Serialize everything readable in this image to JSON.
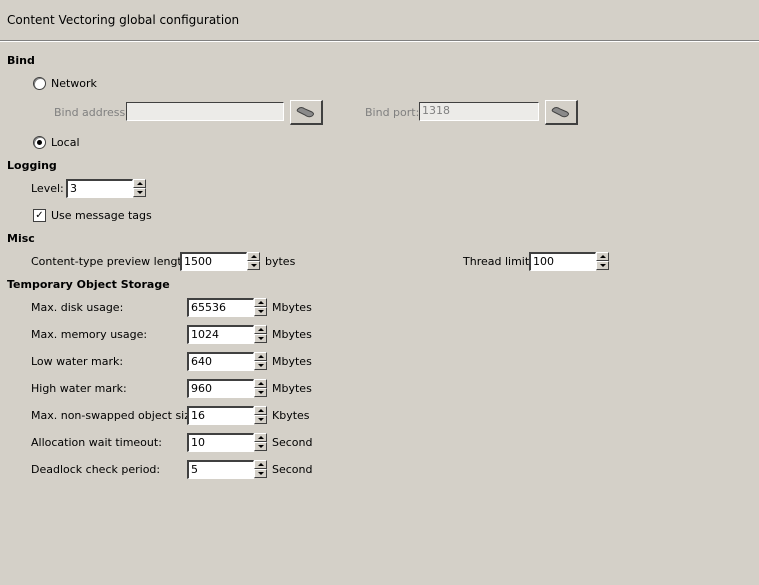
{
  "title": "Content Vectoring global configuration",
  "bind": {
    "heading": "Bind",
    "network": {
      "label": "Network",
      "selected": false
    },
    "bind_address": {
      "label": "Bind address:",
      "value": ""
    },
    "bind_port": {
      "label": "Bind port:",
      "value": "1318"
    },
    "local": {
      "label": "Local",
      "selected": true
    },
    "browse_icon": "network-plug-icon"
  },
  "logging": {
    "heading": "Logging",
    "level": {
      "label": "Level:",
      "value": "3"
    },
    "use_message_tags": {
      "label": "Use message tags",
      "checked": true,
      "mark": "✓"
    }
  },
  "misc": {
    "heading": "Misc",
    "preview_length": {
      "label": "Content-type preview length:",
      "value": "1500",
      "unit": "bytes"
    },
    "thread_limit": {
      "label": "Thread limit:",
      "value": "100"
    }
  },
  "storage": {
    "heading": "Temporary Object Storage",
    "rows": [
      {
        "label": "Max. disk usage:",
        "value": "65536",
        "unit": "Mbytes"
      },
      {
        "label": "Max. memory usage:",
        "value": "1024",
        "unit": "Mbytes"
      },
      {
        "label": "Low water mark:",
        "value": "640",
        "unit": "Mbytes"
      },
      {
        "label": "High water mark:",
        "value": "960",
        "unit": "Mbytes"
      },
      {
        "label": "Max. non-swapped object size:",
        "value": "16",
        "unit": "Kbytes"
      },
      {
        "label": "Allocation wait timeout:",
        "value": "10",
        "unit": "Second"
      },
      {
        "label": "Deadlock check period:",
        "value": "5",
        "unit": "Second"
      }
    ]
  }
}
